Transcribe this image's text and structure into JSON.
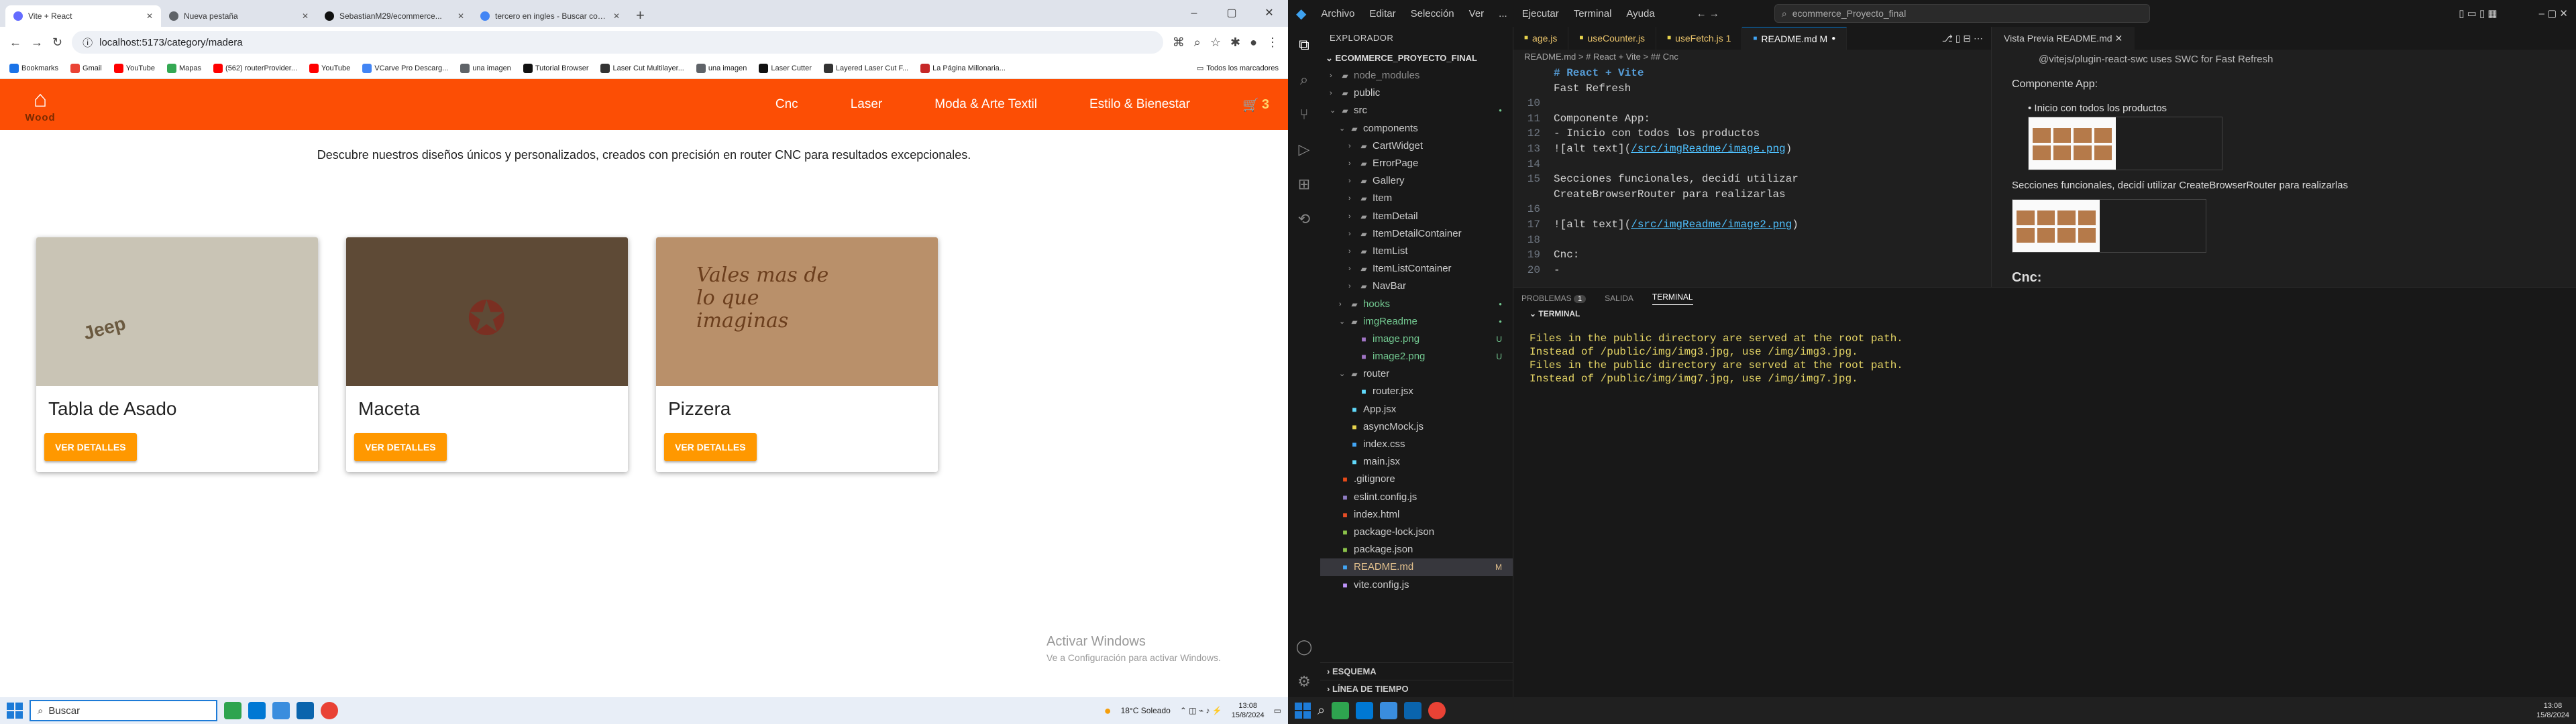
{
  "browser": {
    "tabs": [
      {
        "title": "Vite + React",
        "color": "#646cff"
      },
      {
        "title": "Nueva pestaña",
        "color": "#5f6368"
      },
      {
        "title": "SebastianM29/ecommerce...",
        "color": "#111111"
      },
      {
        "title": "tercero en ingles - Buscar con Google",
        "color": "#4285f4"
      }
    ],
    "url": "localhost:5173/category/madera",
    "bookmarks": [
      "Bookmarks",
      "Gmail",
      "YouTube",
      "Mapas",
      "(562) routerProvider...",
      "YouTube",
      "VCarve Pro Descarg...",
      "una imagen",
      "Tutorial Browser",
      "Laser Cut Multilayer...",
      "una imagen",
      "Laser Cutter",
      "Layered Laser Cut F...",
      "La Página Millonaria..."
    ],
    "all_bookmarks": "Todos los marcadores"
  },
  "site": {
    "logo_text": "Wood",
    "nav": [
      "Cnc",
      "Laser",
      "Moda & Arte Textil",
      "Estilo & Bienestar"
    ],
    "cart_count": "3",
    "tagline": "Descubre nuestros diseños únicos y personalizados, creados con precisión en router CNC para resultados excepcionales.",
    "products": [
      {
        "title": "Tabla de Asado",
        "button": "VER DETALLES",
        "color": "#c9c4b5"
      },
      {
        "title": "Maceta",
        "button": "VER DETALLES",
        "color": "#5e4a36"
      },
      {
        "title": "Pizzera",
        "button": "VER DETALLES",
        "color": "#b9906a"
      }
    ],
    "product_image_text": "Vales mas de lo que imaginas",
    "jeep_text": "Jeep"
  },
  "activate": {
    "title": "Activar Windows",
    "sub": "Ve a Configuración para activar Windows."
  },
  "taskbar_left": {
    "search": "Buscar",
    "weather": "18°C  Soleado",
    "time": "13:08",
    "date": "15/8/2024"
  },
  "vscode": {
    "menu": [
      "Archivo",
      "Editar",
      "Selección",
      "Ver",
      "...",
      "Ejecutar",
      "Terminal",
      "Ayuda"
    ],
    "search": "ecommerce_Proyecto_final",
    "explorer_title": "EXPLORADOR",
    "project": "ECOMMERCE_PROYECTO_FINAL",
    "tree": [
      {
        "d": 1,
        "t": "folder",
        "n": "node_modules",
        "dim": true
      },
      {
        "d": 1,
        "t": "folder",
        "n": "public"
      },
      {
        "d": 1,
        "t": "open",
        "n": "src",
        "dot": "#73c991"
      },
      {
        "d": 2,
        "t": "open",
        "n": "components"
      },
      {
        "d": 3,
        "t": "folder",
        "n": "CartWidget"
      },
      {
        "d": 3,
        "t": "folder",
        "n": "ErrorPage"
      },
      {
        "d": 3,
        "t": "folder",
        "n": "Gallery"
      },
      {
        "d": 3,
        "t": "folder",
        "n": "Item"
      },
      {
        "d": 3,
        "t": "folder",
        "n": "ItemDetail"
      },
      {
        "d": 3,
        "t": "folder",
        "n": "ItemDetailContainer"
      },
      {
        "d": 3,
        "t": "folder",
        "n": "ItemList"
      },
      {
        "d": 3,
        "t": "folder",
        "n": "ItemListContainer"
      },
      {
        "d": 3,
        "t": "folder",
        "n": "NavBar"
      },
      {
        "d": 2,
        "t": "folder",
        "n": "hooks",
        "c": "#73c991",
        "dot": "#73c991"
      },
      {
        "d": 2,
        "t": "open",
        "n": "imgReadme",
        "c": "#73c991",
        "dot": "#73c991"
      },
      {
        "d": 3,
        "t": "file",
        "n": "image.png",
        "c": "#73c991",
        "badge": "U",
        "ic": "#a074c4"
      },
      {
        "d": 3,
        "t": "file",
        "n": "image2.png",
        "c": "#73c991",
        "badge": "U",
        "ic": "#a074c4"
      },
      {
        "d": 2,
        "t": "open",
        "n": "router"
      },
      {
        "d": 3,
        "t": "file",
        "n": "router.jsx",
        "ic": "#61dafb"
      },
      {
        "d": 2,
        "t": "file",
        "n": "App.jsx",
        "ic": "#61dafb"
      },
      {
        "d": 2,
        "t": "file",
        "n": "asyncMock.js",
        "ic": "#e8d44d"
      },
      {
        "d": 2,
        "t": "file",
        "n": "index.css",
        "ic": "#42a5f5"
      },
      {
        "d": 2,
        "t": "file",
        "n": "main.jsx",
        "ic": "#61dafb"
      },
      {
        "d": 1,
        "t": "file",
        "n": ".gitignore",
        "ic": "#e64a19"
      },
      {
        "d": 1,
        "t": "file",
        "n": "eslint.config.js",
        "ic": "#8e7cc3"
      },
      {
        "d": 1,
        "t": "file",
        "n": "index.html",
        "ic": "#e44d26"
      },
      {
        "d": 1,
        "t": "file",
        "n": "package-lock.json",
        "ic": "#8bc34a"
      },
      {
        "d": 1,
        "t": "file",
        "n": "package.json",
        "ic": "#8bc34a"
      },
      {
        "d": 1,
        "t": "file",
        "n": "README.md",
        "sel": true,
        "badge": "M",
        "ic": "#42a5f5",
        "c": "#e2c08d"
      },
      {
        "d": 1,
        "t": "file",
        "n": "vite.config.js",
        "ic": "#bd93f9"
      }
    ],
    "outline": "ESQUEMA",
    "timeline": "LÍNEA DE TIEMPO",
    "tabs": [
      {
        "n": "age.js",
        "c": "#e8d44d"
      },
      {
        "n": "useCounter.js",
        "c": "#e8d44d"
      },
      {
        "n": "useFetch.js 1",
        "c": "#e8d44d"
      },
      {
        "n": "README.md M",
        "c": "#42a5f5",
        "active": true
      }
    ],
    "breadcrumb": "README.md > # React + Vite > ## Cnc",
    "code": [
      {
        "n": "",
        "t": "# React + Vite",
        "h": true
      },
      {
        "n": "",
        "t": "Fast Refresh"
      },
      {
        "n": "10",
        "t": ""
      },
      {
        "n": "11",
        "t": "Componente App:"
      },
      {
        "n": "12",
        "t": "- Inicio con todos los productos"
      },
      {
        "n": "13",
        "t": "![alt text](/src/imgReadme/image.png)",
        "link": "/src/imgReadme/image.png",
        "pre": "![alt text](",
        "post": ")"
      },
      {
        "n": "14",
        "t": ""
      },
      {
        "n": "15",
        "t": "Secciones funcionales, decidí utilizar"
      },
      {
        "n": "",
        "t": "CreateBrowserRouter para realizarlas"
      },
      {
        "n": "16",
        "t": ""
      },
      {
        "n": "17",
        "t": "![alt text](/src/imgReadme/image2.png)",
        "link": "/src/imgReadme/image2.png",
        "pre": "![alt text](",
        "post": ")"
      },
      {
        "n": "18",
        "t": ""
      },
      {
        "n": "19",
        "t": "Cnc:"
      },
      {
        "n": "20",
        "t": "-"
      }
    ],
    "preview_tab": "Vista Previa README.md",
    "preview": {
      "top": "@vitejs/plugin-react-swc uses SWC for Fast Refresh",
      "h_app": "Componente App:",
      "li": "Inicio con todos los productos",
      "p2": "Secciones funcionales, decidí utilizar CreateBrowserRouter para realizarlas",
      "h_cnc": "Cnc:"
    },
    "panel_tabs": [
      "PROBLEMAS",
      "SALIDA",
      "TERMINAL"
    ],
    "problems_count": "1",
    "terminal_label": "TERMINAL",
    "terminal": [
      "Files in the public directory are served at the root path.",
      "Instead of /public/img/img3.jpg, use /img/img3.jpg.",
      "Files in the public directory are served at the root path.",
      "Instead of /public/img/img7.jpg, use /img/img7.jpg."
    ]
  },
  "taskbar_right": {
    "time": "13:08",
    "date": "15/8/2024"
  }
}
